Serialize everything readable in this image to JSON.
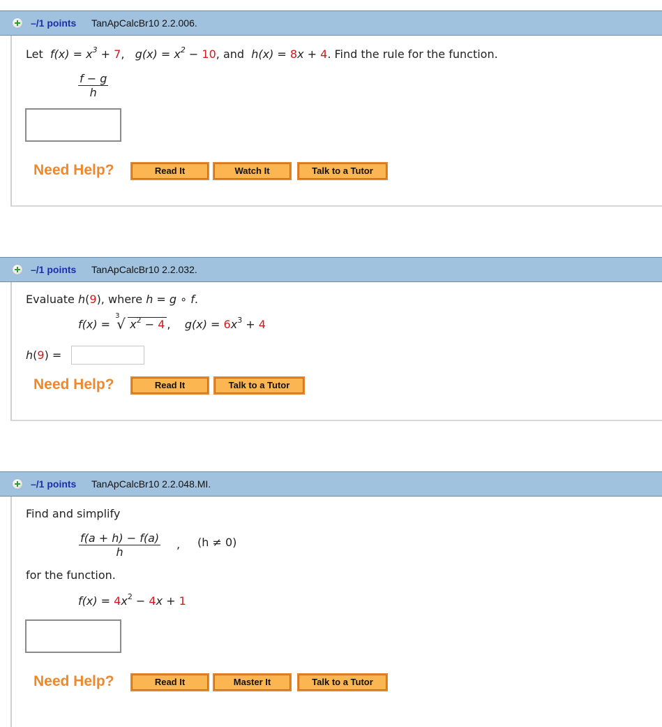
{
  "questions": [
    {
      "points": "–/1 points",
      "code": "TanApCalcBr10 2.2.006.",
      "prompt": {
        "let": "Let",
        "f_lhs": "f(x) = x",
        "f_exp": "3",
        "f_plus": " + ",
        "f_const": "7",
        "sep1": ",",
        "g_lhs": "g(x) = x",
        "g_exp": "2",
        "g_minus": " − ",
        "g_const": "10",
        "sep2": ", and",
        "h_lhs": "h(x) = ",
        "h_coef": "8",
        "h_x": "x + ",
        "h_const": "4",
        "tail": ". Find the rule for the function."
      },
      "expression": {
        "numerator": "f − g",
        "denominator": "h"
      },
      "answer_value": "",
      "need_help": "Need Help?",
      "buttons": [
        "Read It",
        "Watch It",
        "Talk to a Tutor"
      ]
    },
    {
      "points": "–/1 points",
      "code": "TanApCalcBr10 2.2.032.",
      "prompt": {
        "evaluate": "Evaluate ",
        "h": "h",
        "open": "(",
        "arg": "9",
        "close": "), where ",
        "comp": "h = g ∘ f",
        "period": ".",
        "f_lhs": "f(x) = ",
        "root_index": "3",
        "root_sign": "√",
        "radicand_x": "x",
        "radicand_exp": "2",
        "radicand_minus": " − ",
        "radicand_const": "4",
        "comma": ",",
        "g_lhs": "g(x) = ",
        "g_coef": "6",
        "g_x": "x",
        "g_exp": "3",
        "g_plus": " + ",
        "g_const": "4"
      },
      "answer_label": {
        "h": "h",
        "open": "(",
        "arg": "9",
        "close": ") ="
      },
      "answer_value": "",
      "need_help": "Need Help?",
      "buttons": [
        "Read It",
        "Talk to a Tutor"
      ]
    },
    {
      "points": "–/1 points",
      "code": "TanApCalcBr10 2.2.048.MI.",
      "prompt": {
        "intro": "Find and simplify",
        "numerator": "f(a + h) − f(a)",
        "denominator": "h",
        "comma": ",",
        "condition": "(h ≠ 0)",
        "for": "for the function.",
        "f_lhs": "f(x) = ",
        "c1": "4",
        "x2": "x",
        "exp": "2",
        "minus": " − ",
        "c2": "4",
        "x_plus": "x + ",
        "c3": "1"
      },
      "answer_value": "",
      "need_help": "Need Help?",
      "buttons": [
        "Read It",
        "Master It",
        "Talk to a Tutor"
      ]
    }
  ],
  "colors": {
    "header_bg": "#a0c2de",
    "points_text": "#1c2fa8",
    "highlight_red": "#d0191b",
    "need_help": "#f0872a",
    "button_bg": "#fbb651",
    "add_icon": "#2a9d2a"
  }
}
